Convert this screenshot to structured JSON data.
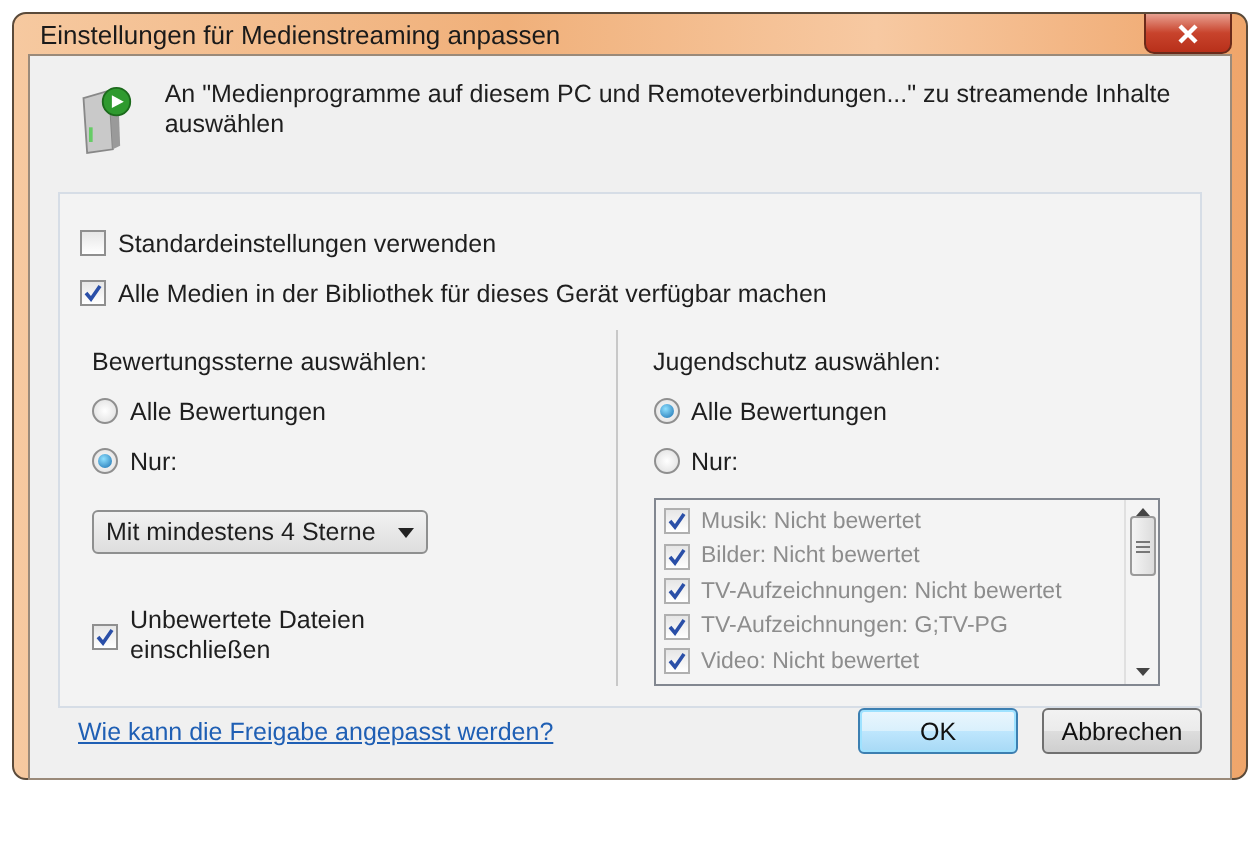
{
  "window": {
    "title": "Einstellungen für Medienstreaming anpassen"
  },
  "header": {
    "text": "An \"Medienprogramme auf diesem PC und Remoteverbindungen...\" zu streamende Inhalte auswählen"
  },
  "options": [
    {
      "label": "Standardeinstellungen verwenden",
      "checked": false
    },
    {
      "label": "Alle Medien in der Bibliothek für dieses Gerät verfügbar machen",
      "checked": true
    }
  ],
  "star_rating": {
    "label": "Bewertungssterne auswählen:",
    "radios": [
      {
        "label": "Alle Bewertungen",
        "selected": false
      },
      {
        "label": "Nur:",
        "selected": true
      }
    ],
    "dropdown": {
      "value": "Mit mindestens 4 Sterne"
    },
    "include_unrated": {
      "label": "Unbewertete Dateien einschließen",
      "checked": true
    }
  },
  "parental": {
    "label": "Jugendschutz auswählen:",
    "radios": [
      {
        "label": "Alle Bewertungen",
        "selected": true
      },
      {
        "label": "Nur:",
        "selected": false
      }
    ],
    "list": {
      "disabled": true,
      "items": [
        {
          "label": "Musik: Nicht bewertet",
          "checked": true
        },
        {
          "label": "Bilder: Nicht bewertet",
          "checked": true
        },
        {
          "label": "TV-Aufzeichnungen: Nicht bewertet",
          "checked": true
        },
        {
          "label": "TV-Aufzeichnungen: G;TV-PG",
          "checked": true
        },
        {
          "label": "Video: Nicht bewertet",
          "checked": true
        }
      ]
    }
  },
  "help_link": "Wie kann die Freigabe angepasst werden?",
  "buttons": [
    {
      "label": "OK",
      "kind": "default"
    },
    {
      "label": "Abbrechen",
      "kind": "normal"
    }
  ]
}
